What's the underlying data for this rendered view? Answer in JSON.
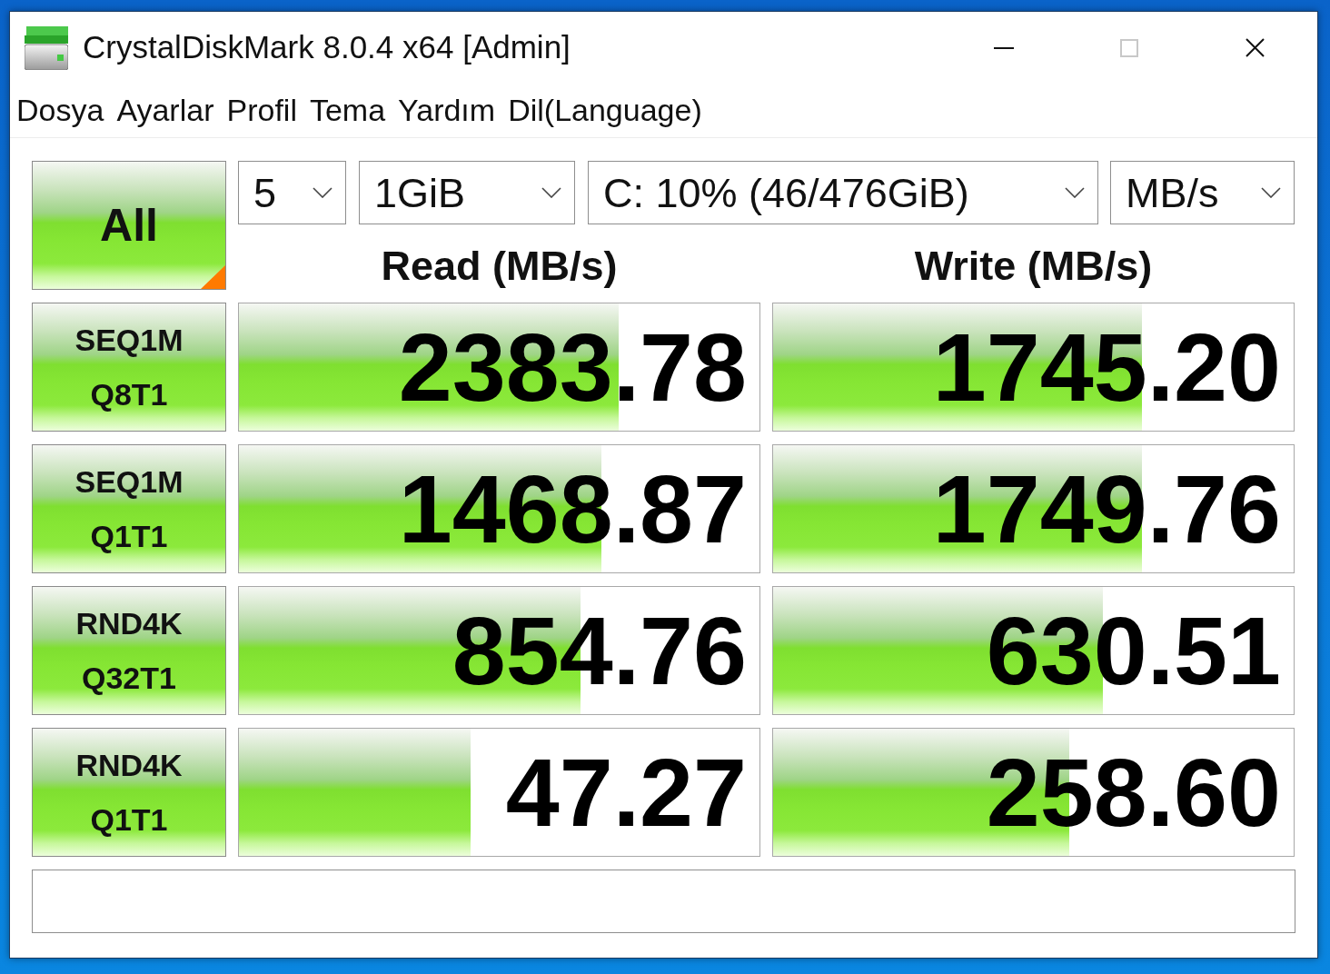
{
  "window": {
    "title": "CrystalDiskMark 8.0.4 x64 [Admin]",
    "controls": [
      {
        "kind": "minimize",
        "disabled": false
      },
      {
        "kind": "maximize",
        "disabled": true
      },
      {
        "kind": "close",
        "disabled": false
      }
    ]
  },
  "menu": [
    "Dosya",
    "Ayarlar",
    "Profil",
    "Tema",
    "Yardım",
    "Dil(Language)"
  ],
  "toolbar": {
    "all_button": {
      "label": "All"
    },
    "selects": [
      {
        "value": "5"
      },
      {
        "value": "1GiB"
      },
      {
        "value": "C: 10% (46/476GiB)"
      },
      {
        "value": "MB/s"
      }
    ]
  },
  "columns": [
    "Read (MB/s)",
    "Write (MB/s)"
  ],
  "rows": [
    {
      "test": [
        "SEQ1M",
        "Q8T1"
      ],
      "read": {
        "value": "2383.78",
        "level": 0.73
      },
      "write": {
        "value": "1745.20",
        "level": 0.708
      }
    },
    {
      "test": [
        "SEQ1M",
        "Q1T1"
      ],
      "read": {
        "value": "1468.87",
        "level": 0.696
      },
      "write": {
        "value": "1749.76",
        "level": 0.708
      }
    },
    {
      "test": [
        "RND4K",
        "Q32T1"
      ],
      "read": {
        "value": "854.76",
        "level": 0.656
      },
      "write": {
        "value": "630.51",
        "level": 0.633
      }
    },
    {
      "test": [
        "RND4K",
        "Q1T1"
      ],
      "read": {
        "value": "47.27",
        "level": 0.445
      },
      "write": {
        "value": "258.60",
        "level": 0.569
      }
    }
  ]
}
